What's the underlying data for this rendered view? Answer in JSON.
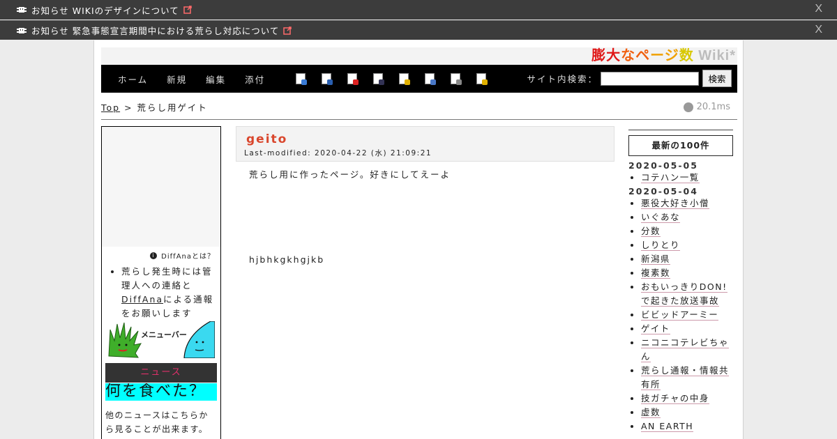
{
  "notices": [
    {
      "label": "お知らせ",
      "text": "WIKIのデザインについて",
      "close": "X"
    },
    {
      "label": "お知らせ",
      "text": "緊急事態宣言期間中における荒らし対応について",
      "close": "X"
    }
  ],
  "site": {
    "logo_parts": [
      "膨",
      "大",
      "な",
      "ペ",
      "ー",
      "ジ",
      "数",
      " Wiki*"
    ]
  },
  "nav": {
    "menu": [
      "ホーム",
      "新規",
      "編集",
      "添付"
    ],
    "icons": [
      "copy-icon",
      "diff-icon",
      "delete-icon",
      "save-icon",
      "lock-icon",
      "list-icon",
      "recent-icon",
      "help-icon"
    ],
    "search_label": "サイト内検索：",
    "search_value": "",
    "search_button": "検索"
  },
  "breadcrumb": {
    "top": "Top",
    "separator": ">",
    "current": "荒らし用ゲイト"
  },
  "timing": "20.1ms",
  "left_menu": {
    "diffana_link": "DiffAnaとは？",
    "notice_before": "荒らし発生時には管理人への連絡と",
    "notice_link": "DiffAna",
    "notice_after": "による通報をお願いします",
    "menubar_label": "メニューバー",
    "news_header": "ニュース",
    "news_headline": "何を食べた？",
    "news_more": "他のニュースはこちらから見ることが出来ます。"
  },
  "article": {
    "page_name": "geito",
    "last_modified": "Last-modified: 2020-04-22 (水) 21:09:21",
    "body_line1": "荒らし用に作ったページ。好きにしてえーよ",
    "body_line2": "hjbhkgkhgjkb"
  },
  "recent": {
    "title": "最新の100件",
    "groups": [
      {
        "date": "2020-05-05",
        "items": [
          "コテハン一覧"
        ]
      },
      {
        "date": "2020-05-04",
        "items": [
          "悪役大好き小僧",
          "いぐあな",
          "分数",
          "しりとり",
          "新潟県",
          "複素数",
          "おもいっきりDON!で起きた放送事故",
          "ビビッドアーミー",
          "ゲイト",
          "ニコニコテレビちゃん",
          "荒らし通報・情報共有所",
          "技ガチャの中身",
          "虚数",
          "AN EARTH"
        ]
      }
    ]
  }
}
